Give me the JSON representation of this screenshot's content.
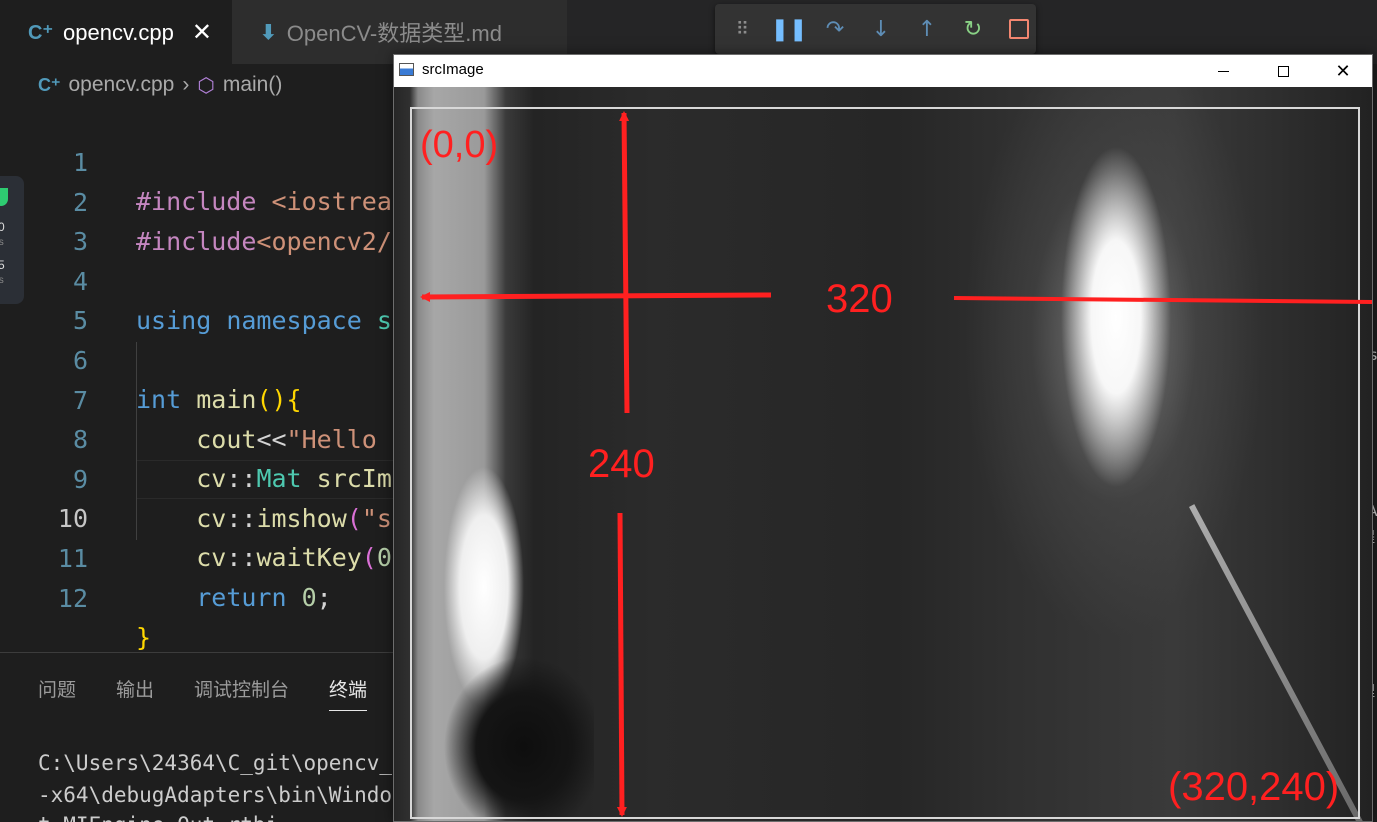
{
  "editor": {
    "tabs": [
      {
        "icon": "cpp-file-icon",
        "label": "opencv.cpp",
        "active": true
      },
      {
        "icon": "markdown-file-icon",
        "label": "OpenCV-数据类型.md",
        "active": false
      }
    ],
    "breadcrumb": {
      "file": "opencv.cpp",
      "symbol": "main()"
    },
    "code_lines": [
      {
        "n": "1",
        "text": "#include <iostrea"
      },
      {
        "n": "2",
        "text": "#include<opencv2/"
      },
      {
        "n": "3",
        "text": ""
      },
      {
        "n": "4",
        "text": "using namespace s"
      },
      {
        "n": "5",
        "text": ""
      },
      {
        "n": "6",
        "text": "int main(){"
      },
      {
        "n": "7",
        "text": "    cout<<\"Hello"
      },
      {
        "n": "8",
        "text": "    cv::Mat srcIm"
      },
      {
        "n": "9",
        "text": "    cv::imshow(\"s"
      },
      {
        "n": "10",
        "text": "    cv::waitKey(0"
      },
      {
        "n": "11",
        "text": "    return 0;"
      },
      {
        "n": "12",
        "text": "}"
      }
    ],
    "current_line": "10"
  },
  "debug_toolbar": {
    "buttons": [
      "drag-grip",
      "pause",
      "step-over",
      "step-into",
      "step-out",
      "restart",
      "stop"
    ]
  },
  "float_widget": {
    "value1": "0",
    "unit1": "/s",
    "value2": "5",
    "unit2": "/s"
  },
  "panel": {
    "tabs": [
      "问题",
      "输出",
      "调试控制台",
      "终端"
    ],
    "active_tab": "终端",
    "terminal_lines": [
      "C:\\Users\\24364\\C_git\\opencv_",
      "-x64\\debugAdapters\\bin\\Windo",
      "t-MIEngine-Out-rtbi"
    ]
  },
  "right_strip": [
    "Es",
    "FA",
    "程",
    "Fi",
    "理"
  ],
  "cv_window": {
    "title": "srcImage",
    "controls": [
      "minimize",
      "maximize",
      "close"
    ],
    "annotations": {
      "origin": "(0,0)",
      "width": "320",
      "height": "240",
      "corner": "(320,240)"
    }
  },
  "colors": {
    "annotation": "#ff2020",
    "keyword": "#569cd6",
    "type": "#4ec9b0",
    "string": "#ce9178",
    "line_number": "#5a8ca3"
  }
}
